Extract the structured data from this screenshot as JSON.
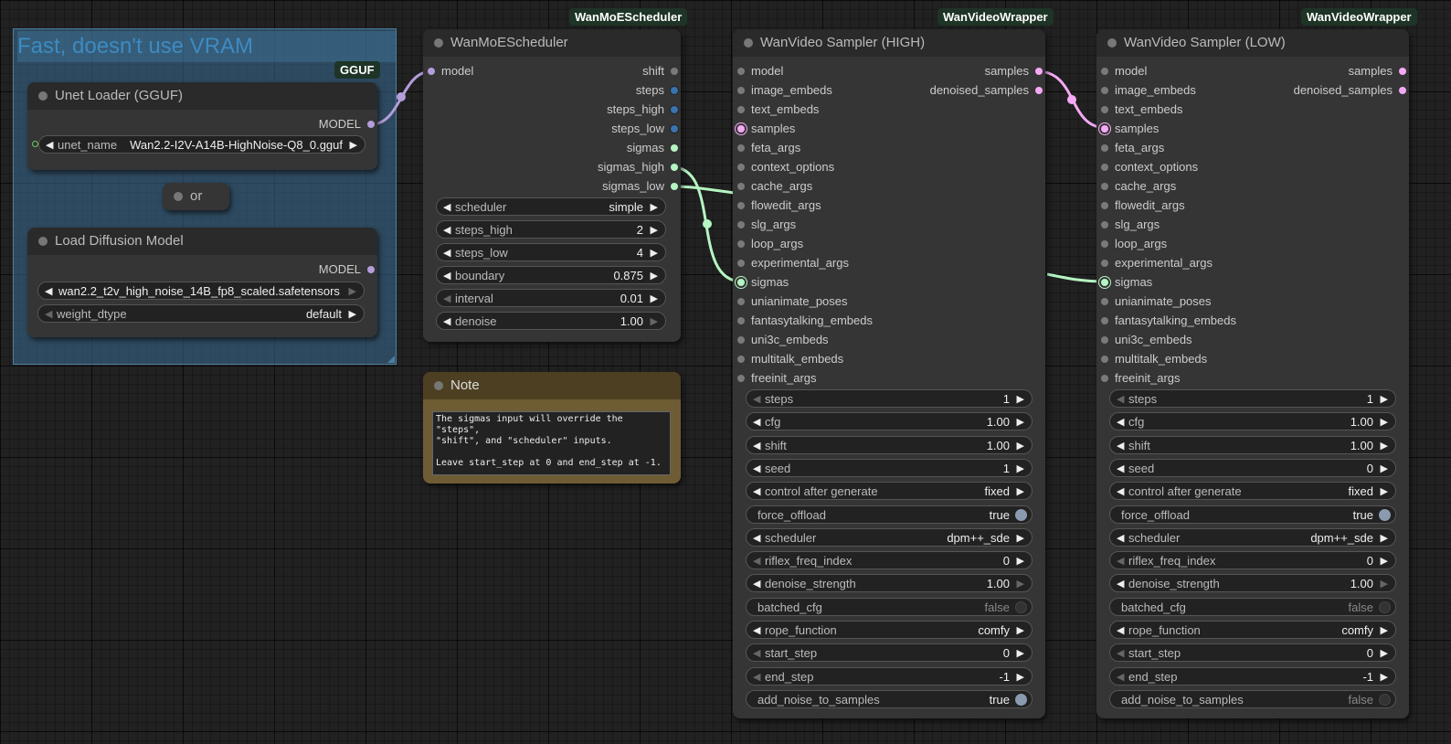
{
  "group": {
    "title": "Fast, doesn't use VRAM"
  },
  "gguf_badge": "GGUF",
  "unet_loader": {
    "title": "Unet Loader (GGUF)",
    "output": "MODEL",
    "unet_label": "unet_name",
    "unet_value": "Wan2.2-I2V-A14B-HighNoise-Q8_0.gguf"
  },
  "or_node": {
    "title": "or"
  },
  "diffusion_loader": {
    "title": "Load Diffusion Model",
    "output": "MODEL",
    "model_value": "wan2.2_t2v_high_noise_14B_fp8_scaled.safetensors",
    "dtype_label": "weight_dtype",
    "dtype_value": "default"
  },
  "scheduler": {
    "badge": "WanMoEScheduler",
    "title": "WanMoEScheduler",
    "input": "model",
    "outputs": [
      "shift",
      "steps",
      "steps_high",
      "steps_low",
      "sigmas",
      "sigmas_high",
      "sigmas_low"
    ],
    "widgets": [
      {
        "label": "scheduler",
        "value": "simple"
      },
      {
        "label": "steps_high",
        "value": "2"
      },
      {
        "label": "steps_low",
        "value": "4"
      },
      {
        "label": "boundary",
        "value": "0.875"
      },
      {
        "label": "interval",
        "value": "0.01"
      },
      {
        "label": "denoise",
        "value": "1.00"
      }
    ]
  },
  "note": {
    "title": "Note",
    "text": "The sigmas input will override the \"steps\",\n\"shift\", and \"scheduler\" inputs.\n\nLeave start_step at 0 and end_step at -1."
  },
  "sampler_high": {
    "badge": "WanVideoWrapper",
    "title": "WanVideo Sampler (HIGH)",
    "inputs": [
      "model",
      "image_embeds",
      "text_embeds",
      "samples",
      "feta_args",
      "context_options",
      "cache_args",
      "flowedit_args",
      "slg_args",
      "loop_args",
      "experimental_args",
      "sigmas",
      "unianimate_poses",
      "fantasytalking_embeds",
      "uni3c_embeds",
      "multitalk_embeds",
      "freeinit_args"
    ],
    "outputs": [
      "samples",
      "denoised_samples"
    ],
    "widgets": [
      {
        "label": "steps",
        "value": "1"
      },
      {
        "label": "cfg",
        "value": "1.00"
      },
      {
        "label": "shift",
        "value": "1.00"
      },
      {
        "label": "seed",
        "value": "1"
      },
      {
        "label": "control after generate",
        "value": "fixed"
      },
      {
        "label": "force_offload",
        "value": "true"
      },
      {
        "label": "scheduler",
        "value": "dpm++_sde"
      },
      {
        "label": "riflex_freq_index",
        "value": "0"
      },
      {
        "label": "denoise_strength",
        "value": "1.00"
      },
      {
        "label": "batched_cfg",
        "value": "false"
      },
      {
        "label": "rope_function",
        "value": "comfy"
      },
      {
        "label": "start_step",
        "value": "0"
      },
      {
        "label": "end_step",
        "value": "-1"
      },
      {
        "label": "add_noise_to_samples",
        "value": "true"
      }
    ]
  },
  "sampler_low": {
    "badge": "WanVideoWrapper",
    "title": "WanVideo Sampler (LOW)",
    "inputs": [
      "model",
      "image_embeds",
      "text_embeds",
      "samples",
      "feta_args",
      "context_options",
      "cache_args",
      "flowedit_args",
      "slg_args",
      "loop_args",
      "experimental_args",
      "sigmas",
      "unianimate_poses",
      "fantasytalking_embeds",
      "uni3c_embeds",
      "multitalk_embeds",
      "freeinit_args"
    ],
    "outputs": [
      "samples",
      "denoised_samples"
    ],
    "widgets": [
      {
        "label": "steps",
        "value": "1"
      },
      {
        "label": "cfg",
        "value": "1.00"
      },
      {
        "label": "shift",
        "value": "1.00"
      },
      {
        "label": "seed",
        "value": "0"
      },
      {
        "label": "control after generate",
        "value": "fixed"
      },
      {
        "label": "force_offload",
        "value": "true"
      },
      {
        "label": "scheduler",
        "value": "dpm++_sde"
      },
      {
        "label": "riflex_freq_index",
        "value": "0"
      },
      {
        "label": "denoise_strength",
        "value": "1.00"
      },
      {
        "label": "batched_cfg",
        "value": "false"
      },
      {
        "label": "rope_function",
        "value": "comfy"
      },
      {
        "label": "start_step",
        "value": "0"
      },
      {
        "label": "end_step",
        "value": "-1"
      },
      {
        "label": "add_noise_to_samples",
        "value": "false"
      }
    ]
  }
}
